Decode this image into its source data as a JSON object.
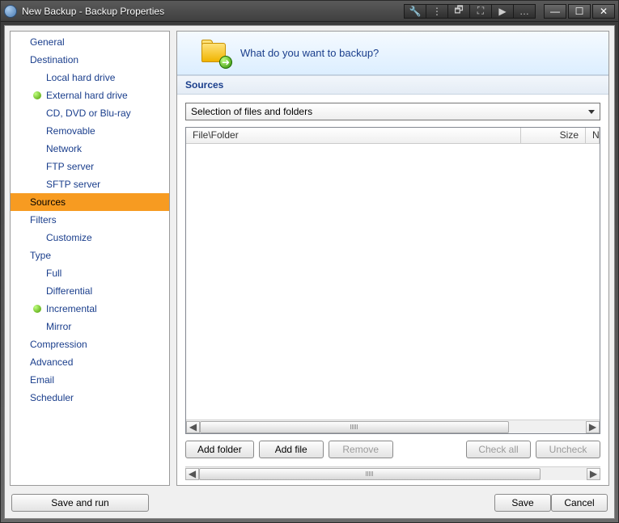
{
  "window": {
    "title": "New Backup - Backup Properties"
  },
  "titlebar_tools": {
    "wrench": "🔧",
    "dots": "⋮",
    "restore": "🗗",
    "full": "⛶",
    "play": "▶",
    "ellipsis": "…"
  },
  "sysbuttons": {
    "min": "—",
    "max": "☐",
    "close": "✕"
  },
  "sidebar": {
    "items": [
      {
        "label": "General",
        "level": 0,
        "bullet": false,
        "selected": false
      },
      {
        "label": "Destination",
        "level": 0,
        "bullet": false,
        "selected": false
      },
      {
        "label": "Local hard drive",
        "level": 1,
        "bullet": false,
        "selected": false
      },
      {
        "label": "External hard drive",
        "level": 1,
        "bullet": true,
        "selected": false
      },
      {
        "label": "CD, DVD or Blu-ray",
        "level": 1,
        "bullet": false,
        "selected": false
      },
      {
        "label": "Removable",
        "level": 1,
        "bullet": false,
        "selected": false
      },
      {
        "label": "Network",
        "level": 1,
        "bullet": false,
        "selected": false
      },
      {
        "label": "FTP server",
        "level": 1,
        "bullet": false,
        "selected": false
      },
      {
        "label": "SFTP server",
        "level": 1,
        "bullet": false,
        "selected": false
      },
      {
        "label": "Sources",
        "level": 0,
        "bullet": false,
        "selected": true
      },
      {
        "label": "Filters",
        "level": 0,
        "bullet": false,
        "selected": false
      },
      {
        "label": "Customize",
        "level": 1,
        "bullet": false,
        "selected": false
      },
      {
        "label": "Type",
        "level": 0,
        "bullet": false,
        "selected": false
      },
      {
        "label": "Full",
        "level": 1,
        "bullet": false,
        "selected": false
      },
      {
        "label": "Differential",
        "level": 1,
        "bullet": false,
        "selected": false
      },
      {
        "label": "Incremental",
        "level": 1,
        "bullet": true,
        "selected": false
      },
      {
        "label": "Mirror",
        "level": 1,
        "bullet": false,
        "selected": false
      },
      {
        "label": "Compression",
        "level": 0,
        "bullet": false,
        "selected": false
      },
      {
        "label": "Advanced",
        "level": 0,
        "bullet": false,
        "selected": false
      },
      {
        "label": "Email",
        "level": 0,
        "bullet": false,
        "selected": false
      },
      {
        "label": "Scheduler",
        "level": 0,
        "bullet": false,
        "selected": false
      }
    ]
  },
  "banner": {
    "question": "What do you want to backup?",
    "arrow": "➜"
  },
  "section": {
    "title": "Sources"
  },
  "dropdown": {
    "selected": "Selection of files and folders"
  },
  "table": {
    "columns": {
      "file": "File\\Folder",
      "size": "Size",
      "last": "N"
    },
    "rows": []
  },
  "buttons": {
    "add_folder": "Add folder",
    "add_file": "Add file",
    "remove": "Remove",
    "check_all": "Check all",
    "uncheck_all": "Uncheck"
  },
  "footer": {
    "save_run": "Save and run",
    "save": "Save",
    "cancel": "Cancel"
  },
  "scrollbars": {
    "left_arrow": "◀",
    "right_arrow": "▶"
  }
}
